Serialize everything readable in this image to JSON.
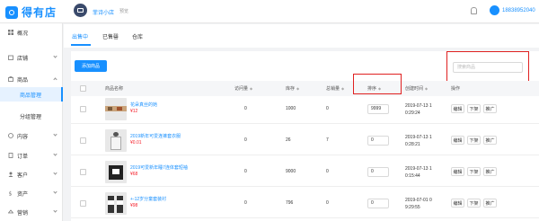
{
  "header": {
    "brand": "得有店",
    "shop_name": "菲诗小店",
    "shop_tag": "预览",
    "user_phone": "18838952040"
  },
  "sidebar": {
    "items": [
      {
        "label": "概况",
        "icon": "grid-icon"
      },
      {
        "label": "店铺",
        "icon": "store-icon"
      },
      {
        "label": "商品",
        "icon": "goods-icon"
      },
      {
        "label": "商品管理",
        "icon": ""
      },
      {
        "label": "分组管理",
        "icon": ""
      },
      {
        "label": "内容",
        "icon": "content-icon"
      },
      {
        "label": "订单",
        "icon": "order-icon"
      },
      {
        "label": "客户",
        "icon": "customer-icon"
      },
      {
        "label": "资产",
        "icon": "asset-icon"
      },
      {
        "label": "营销",
        "icon": "marketing-icon"
      }
    ]
  },
  "tabs": [
    "出售中",
    "已售罄",
    "仓库"
  ],
  "toolbar": {
    "add_label": "添加商品",
    "search_placeholder": "搜索商品"
  },
  "table": {
    "headers": [
      "商品名称",
      "访问量",
      "库存",
      "总销量",
      "排序",
      "创建时间",
      "操作"
    ],
    "rows": [
      {
        "name": "花朵真丝的她",
        "price": "¥12",
        "visits": "0",
        "stock": "1000",
        "sales": "0",
        "sort": "9999",
        "date": "2019-07-13 1",
        "time": "0:29:24",
        "thumb": "strip"
      },
      {
        "name": "2019新年可爱连裤套衣服",
        "price": "¥0.01",
        "visits": "0",
        "stock": "26",
        "sales": "7",
        "sort": "0",
        "date": "2019-07-13 1",
        "time": "0:28:21",
        "thumb": "dress"
      },
      {
        "name": "2019可爱新年睡7连体套短袖",
        "price": "¥68",
        "visits": "0",
        "stock": "9000",
        "sales": "0",
        "sort": "0",
        "date": "2019-07-13 1",
        "time": "0:15:44",
        "thumb": "tshirt"
      },
      {
        "name": "+-12岁分童套装衬",
        "price": "¥98",
        "visits": "0",
        "stock": "796",
        "sales": "0",
        "sort": "0",
        "date": "2019-07-01 0",
        "time": "9:29:55",
        "thumb": "kids"
      }
    ],
    "actions": [
      "编辑",
      "下架",
      "推广"
    ]
  },
  "colors": {
    "accent": "#1890ff",
    "price": "#f5222d",
    "highlight": "#e02020"
  }
}
